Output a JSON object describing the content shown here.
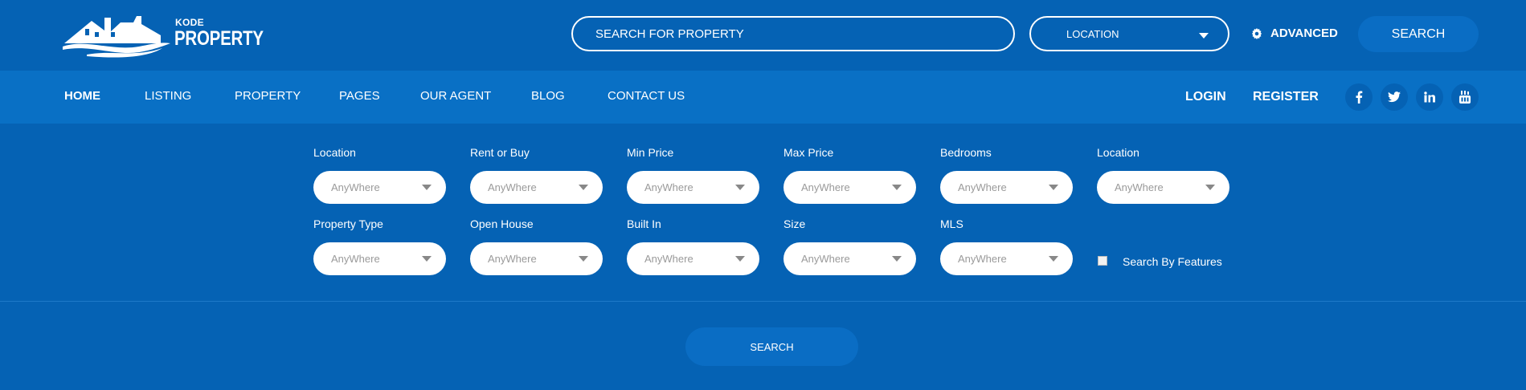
{
  "logo": {
    "small": "KODE",
    "big": "PROPERTY"
  },
  "header": {
    "search_placeholder": "SEARCH FOR PROPERTY",
    "location_label": "LOCATION",
    "advanced_label": "ADVANCED",
    "search_button": "SEARCH"
  },
  "nav": {
    "items": [
      "HOME",
      "LISTING",
      "PROPERTY",
      "PAGES",
      "OUR AGENT",
      "BLOG",
      "CONTACT US"
    ],
    "login": "LOGIN",
    "register": "REGISTER",
    "social_icons": [
      "facebook-icon",
      "twitter-icon",
      "linkedin-icon",
      "youtube-icon"
    ]
  },
  "filters": {
    "row1": [
      {
        "label": "Location",
        "value": "AnyWhere"
      },
      {
        "label": "Rent or Buy",
        "value": "AnyWhere"
      },
      {
        "label": "Min Price",
        "value": "AnyWhere"
      },
      {
        "label": "Max Price",
        "value": "AnyWhere"
      },
      {
        "label": "Bedrooms",
        "value": "AnyWhere"
      },
      {
        "label": "Location",
        "value": "AnyWhere"
      }
    ],
    "row2": [
      {
        "label": "Property Type",
        "value": "AnyWhere"
      },
      {
        "label": "Open House",
        "value": "AnyWhere"
      },
      {
        "label": "Built In",
        "value": "AnyWhere"
      },
      {
        "label": "Size",
        "value": "AnyWhere"
      },
      {
        "label": "MLS",
        "value": "AnyWhere"
      }
    ],
    "features_label": "Search By Features",
    "search_button": "SEARCH"
  },
  "colors": {
    "background": "#0562b4",
    "nav_background": "#0970c5",
    "button": "#0a6dc4",
    "select_bg": "#ffffff",
    "select_text": "#9a9a9a"
  }
}
